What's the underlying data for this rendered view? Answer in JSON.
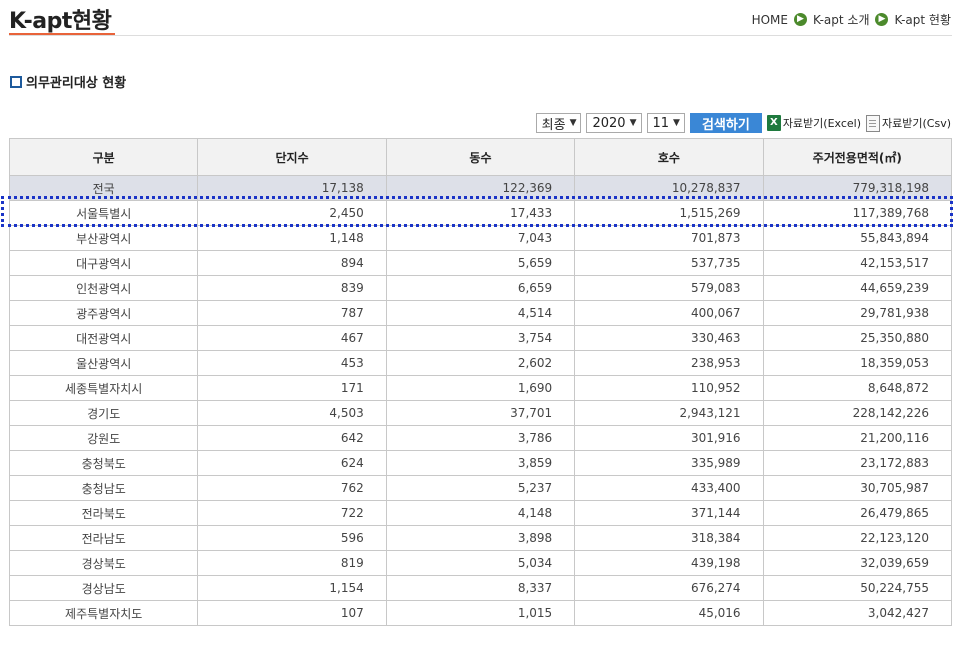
{
  "header": {
    "title": "K-apt현황",
    "breadcrumb": [
      "HOME",
      "K-apt 소개",
      "K-apt 현황"
    ]
  },
  "section": {
    "title": "의무관리대상 현황"
  },
  "toolbar": {
    "type_select": "최종",
    "year_select": "2020",
    "month_select": "11",
    "search_label": "검색하기",
    "excel_label": "자료받기(Excel)",
    "csv_label": "자료받기(Csv)"
  },
  "table": {
    "columns": [
      "구분",
      "단지수",
      "동수",
      "호수",
      "주거전용면적(㎡)"
    ],
    "total": [
      "전국",
      "17,138",
      "122,369",
      "10,278,837",
      "779,318,198"
    ],
    "rows": [
      [
        "서울특별시",
        "2,450",
        "17,433",
        "1,515,269",
        "117,389,768"
      ],
      [
        "부산광역시",
        "1,148",
        "7,043",
        "701,873",
        "55,843,894"
      ],
      [
        "대구광역시",
        "894",
        "5,659",
        "537,735",
        "42,153,517"
      ],
      [
        "인천광역시",
        "839",
        "6,659",
        "579,083",
        "44,659,239"
      ],
      [
        "광주광역시",
        "787",
        "4,514",
        "400,067",
        "29,781,938"
      ],
      [
        "대전광역시",
        "467",
        "3,754",
        "330,463",
        "25,350,880"
      ],
      [
        "울산광역시",
        "453",
        "2,602",
        "238,953",
        "18,359,053"
      ],
      [
        "세종특별자치시",
        "171",
        "1,690",
        "110,952",
        "8,648,872"
      ],
      [
        "경기도",
        "4,503",
        "37,701",
        "2,943,121",
        "228,142,226"
      ],
      [
        "강원도",
        "642",
        "3,786",
        "301,916",
        "21,200,116"
      ],
      [
        "충청북도",
        "624",
        "3,859",
        "335,989",
        "23,172,883"
      ],
      [
        "충청남도",
        "762",
        "5,237",
        "433,400",
        "30,705,987"
      ],
      [
        "전라북도",
        "722",
        "4,148",
        "371,144",
        "26,479,865"
      ],
      [
        "전라남도",
        "596",
        "3,898",
        "318,384",
        "22,123,120"
      ],
      [
        "경상북도",
        "819",
        "5,034",
        "439,198",
        "32,039,659"
      ],
      [
        "경상남도",
        "1,154",
        "8,337",
        "676,274",
        "50,224,755"
      ],
      [
        "제주특별자치도",
        "107",
        "1,015",
        "45,016",
        "3,042,427"
      ]
    ]
  }
}
